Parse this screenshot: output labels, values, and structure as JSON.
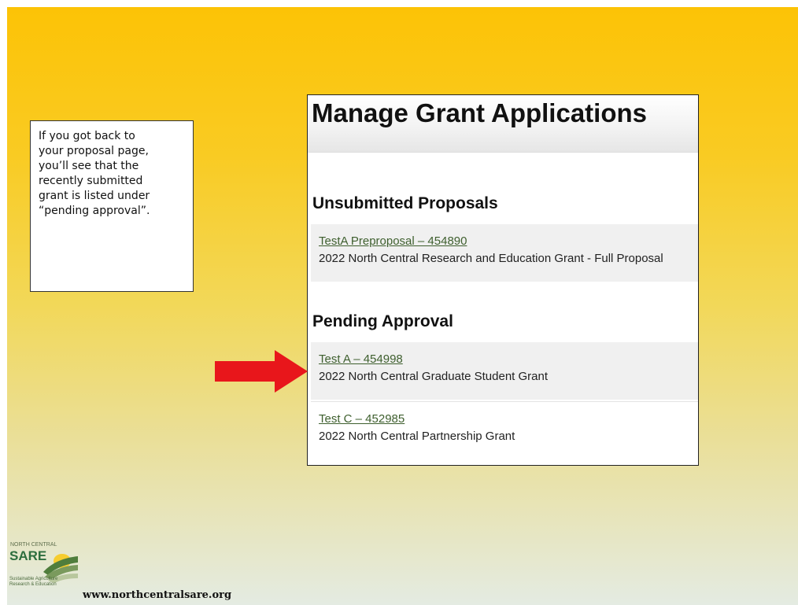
{
  "callout": {
    "lines": [
      "If you got back to",
      "your proposal page,",
      "you’ll see that the",
      "recently submitted",
      "grant is listed under",
      "“pending approval”."
    ]
  },
  "screenshot": {
    "title": "Manage Grant Applications",
    "unsubmitted": {
      "heading": "Unsubmitted Proposals",
      "items": [
        {
          "link": "TestA Preproposal – 454890",
          "desc": "2022 North Central Research and Education Grant - Full Proposal"
        }
      ]
    },
    "pending": {
      "heading": "Pending Approval",
      "items": [
        {
          "link": "Test A – 454998",
          "desc": "2022 North Central Graduate Student Grant"
        },
        {
          "link": "Test C – 452985",
          "desc": "2022 North Central Partnership Grant"
        }
      ]
    }
  },
  "logo": {
    "top_text": "NORTH CENTRAL",
    "name": "SARE",
    "sub1": "Sustainable Agriculture",
    "sub2": "Research & Education"
  },
  "footer": {
    "url": "www.northcentralsare.org"
  },
  "colors": {
    "arrow": "#e8161b",
    "link": "#3e5f2e"
  }
}
